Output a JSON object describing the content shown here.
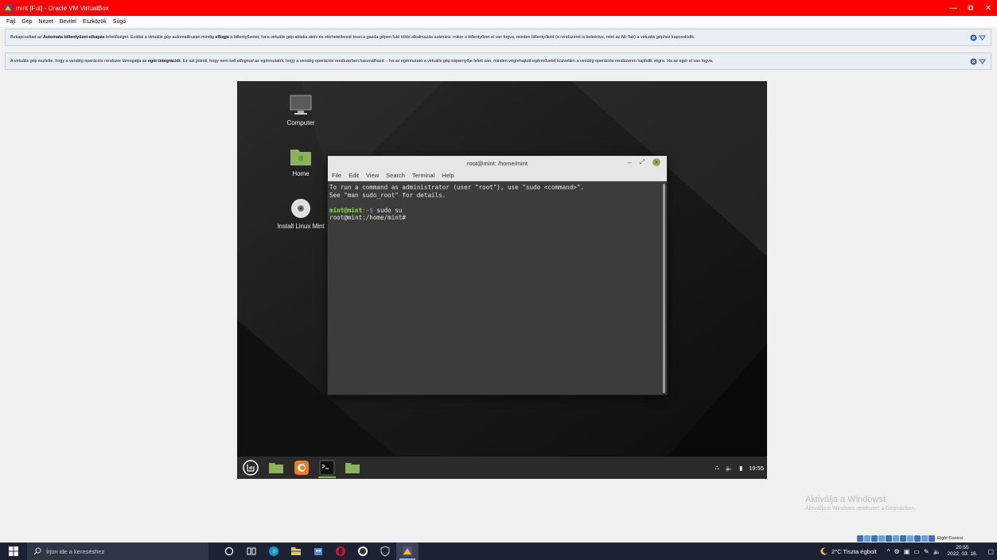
{
  "window": {
    "title": "mint [Fut] - Oracle VM VirtualBox",
    "controls": {
      "minimize": "—",
      "maximize": "⧉",
      "close": "✕"
    }
  },
  "menubar": [
    "Fájl",
    "Gép",
    "Nézet",
    "Bevitel",
    "Eszközök",
    "Súgó"
  ],
  "notifications": {
    "keyboard": {
      "pre": "Bekapcsoltad az ",
      "bold1": "Automata billentyűzet-elkapás",
      "mid": " lehetőséget. Ezáltal a virtuális gép automatikusan mindig ",
      "bold2": "elfogja",
      "post": " a billentyűzetet, ha a virtuális gép ablaka aktív és elérhetetlenné teszi a gazda gépen futó többi alkalmazás számára: mikor a billentyűzet el van fogva, minden billentyűkód (a rendszerét is beleértve, mint az Alt-Tab) a virtuális géphez kapcsolódik."
    },
    "mouse": {
      "pre": "A virtuális gép észlelte, hogy a vendég operációs rendszer támogatja az ",
      "bold1": "egér-integrációt",
      "mid": ". Ez azt jelenti, hogy nem kell ",
      "italic": "elfognod",
      "post": " az egérmutatót, hogy a vendég operációs rendszerben használhasd -- ha az egérmutató a virtuális gép képernyője felett van, minden végrehajtott egérművelet közvetlen a vendég operációs rendszeren hajtódik végre. Ha az egér el van fogva,"
    }
  },
  "desktop": {
    "icons": [
      {
        "label": "Computer",
        "icon": "computer-icon"
      },
      {
        "label": "Home",
        "icon": "folder-icon"
      },
      {
        "label": "Install Linux Mint",
        "icon": "disc-icon"
      }
    ]
  },
  "terminal": {
    "title": "root@mint: /home/mint",
    "menu": [
      "File",
      "Edit",
      "View",
      "Search",
      "Terminal",
      "Help"
    ],
    "lines": {
      "l1": "To run a command as administrator (user \"root\"), use \"sudo <command>\".",
      "l2": "See \"man sudo_root\" for details.",
      "prompt_user": "mint@mint",
      "prompt_path": ":~$",
      "command": " sudo su",
      "root_prompt": "root@mint:/home/mint#"
    }
  },
  "guest_panel": {
    "apps": [
      "mint-menu-icon",
      "files-icon",
      "firefox-icon",
      "terminal-icon",
      "folder-icon"
    ],
    "clock": "19:55"
  },
  "watermark": {
    "line1": "Aktiválja a Windowst",
    "line2": "Aktiválja a Windows rendszert a Gépházban."
  },
  "vb_status": {
    "hostkey": "Right Control"
  },
  "taskbar": {
    "search_placeholder": "Írjon ide a kereséshez",
    "weather": "2°C  Tiszta égbolt",
    "time": "20:55",
    "date": "2022. 03. 16."
  },
  "colors": {
    "titlebar": "#ff0000",
    "mint_green": "#8bb35c",
    "taskbar": "#1c2232"
  }
}
